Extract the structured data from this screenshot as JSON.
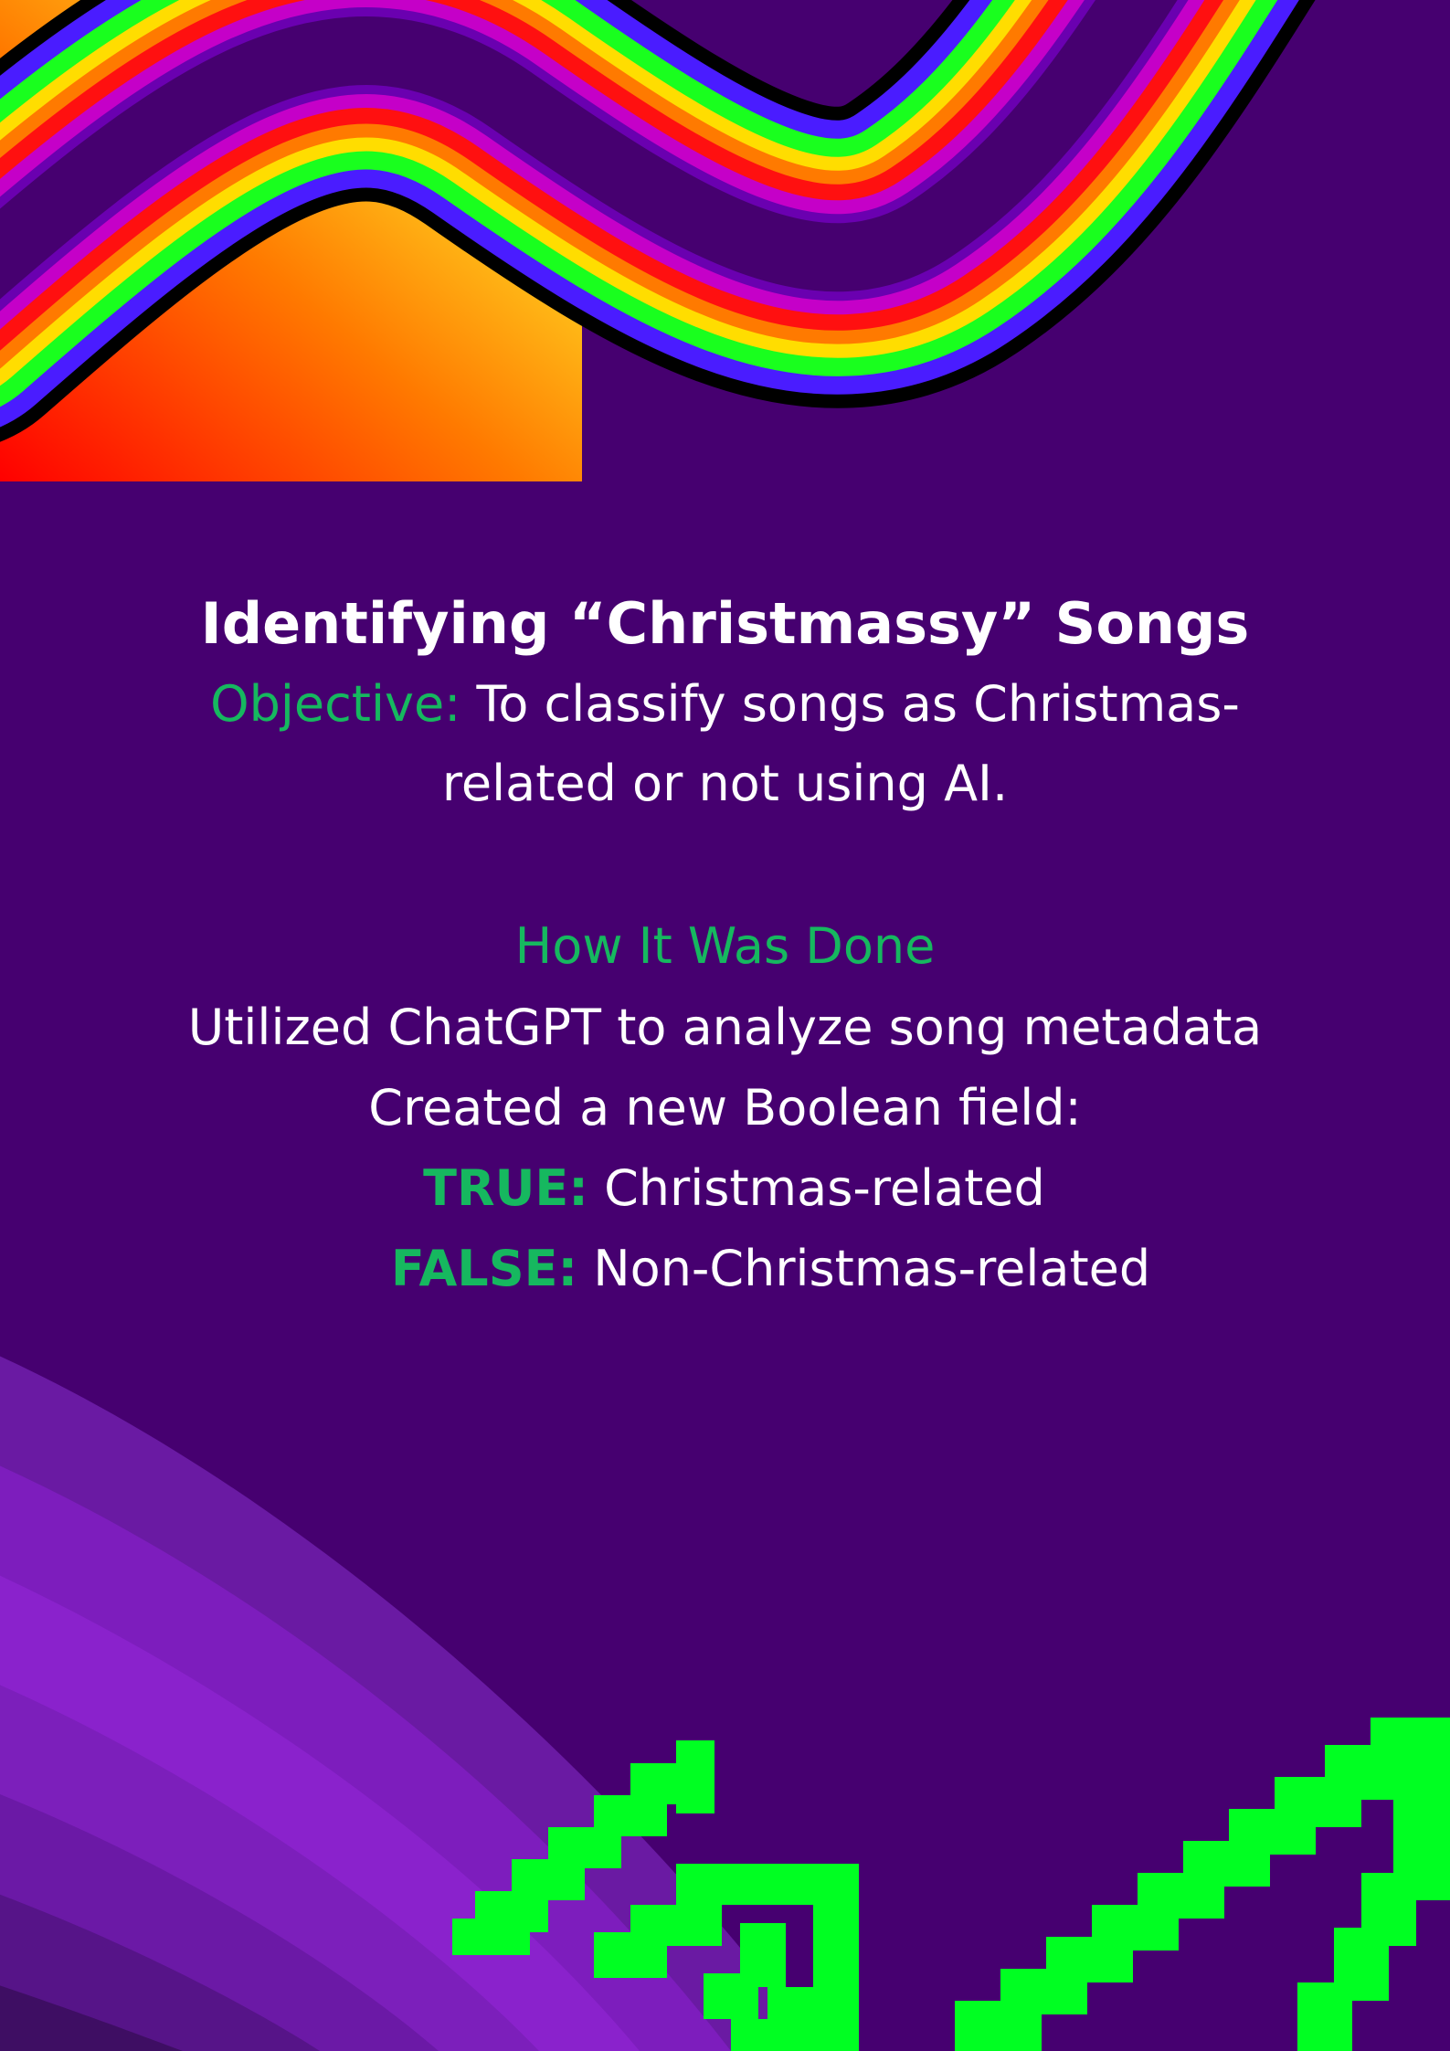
{
  "title": "Identifying “Christmassy” Songs",
  "objective": {
    "label": "Objective:",
    "text_line1": " To classify songs as Christmas-",
    "text_line2": "related or not using AI."
  },
  "method": {
    "heading": "How It Was Done",
    "line1": "Utilized ChatGPT to analyze song metadata",
    "line2": "Created a new Boolean field:",
    "true_label": "TRUE:",
    "true_text": " Christmas-related",
    "false_label": "FALSE:",
    "false_text": " Non-Christmas-related"
  },
  "colors": {
    "background": "#460070",
    "accent_green": "#16b85f",
    "pixel_arrow_green": "#00ff22"
  }
}
